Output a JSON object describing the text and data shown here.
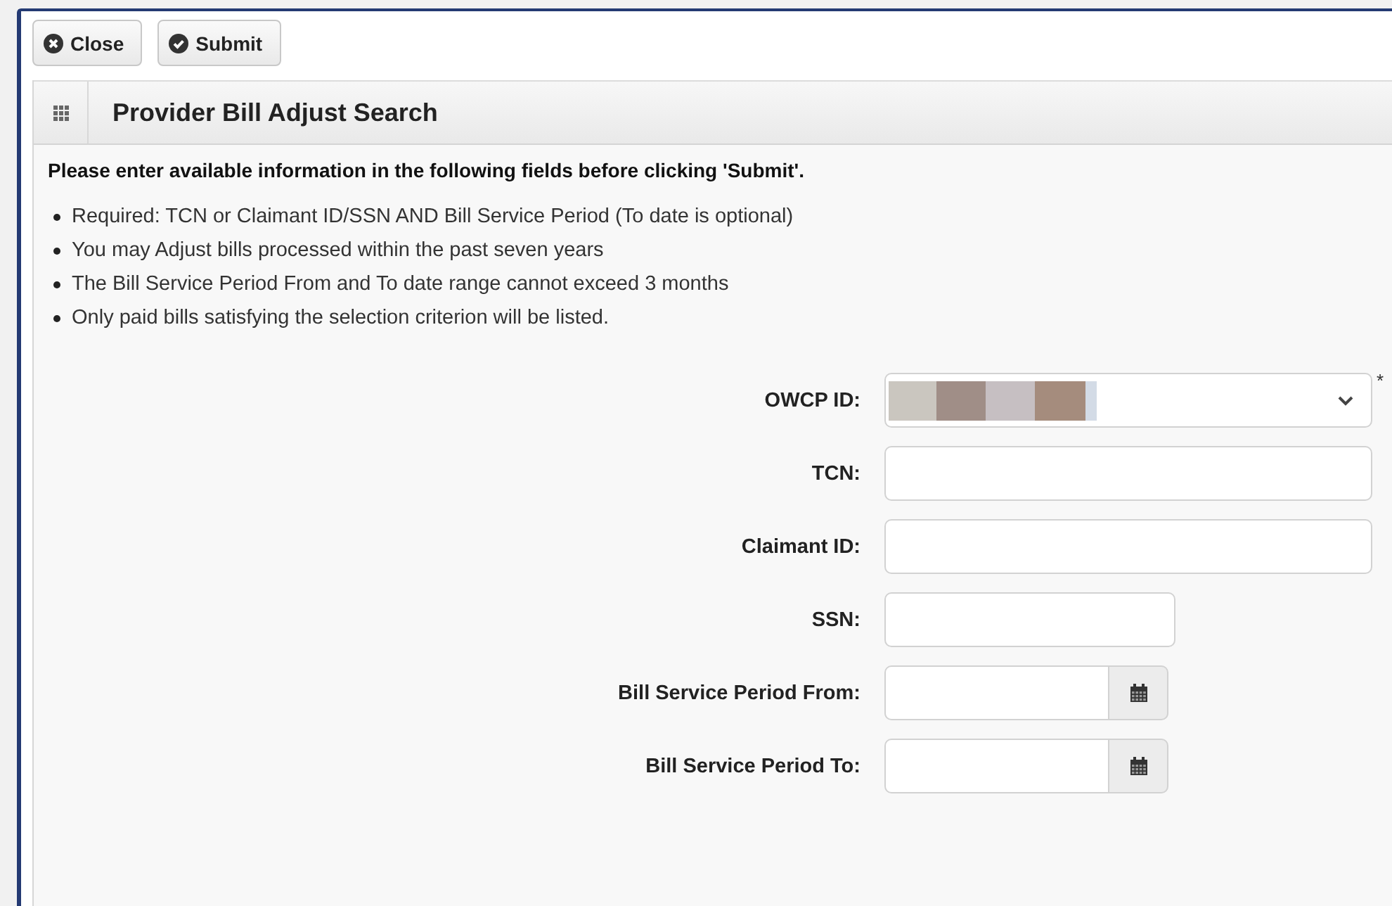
{
  "toolbar": {
    "buttons": [
      {
        "label": "Close"
      },
      {
        "label": "Submit"
      }
    ]
  },
  "panel": {
    "title": "Provider Bill Adjust Search"
  },
  "instruction": "Please enter available information in the following fields before clicking 'Submit'.",
  "notes": [
    "Required: TCN or Claimant ID/SSN AND Bill Service Period (To date is optional)",
    "You may Adjust bills processed within the past seven years",
    "The Bill Service Period From and To date range cannot exceed 3 months",
    "Only paid bills satisfying the selection criterion will be listed."
  ],
  "fields": [
    {
      "label": "OWCP ID:",
      "kind": "select",
      "value_redacted": true,
      "marker": "*"
    },
    {
      "label": "TCN:",
      "kind": "text"
    },
    {
      "label": "Claimant ID:",
      "kind": "text"
    },
    {
      "label": "SSN:",
      "kind": "shorttext"
    },
    {
      "label": "Bill Service Period From:",
      "kind": "date"
    },
    {
      "label": "Bill Service Period To:",
      "kind": "date"
    }
  ]
}
